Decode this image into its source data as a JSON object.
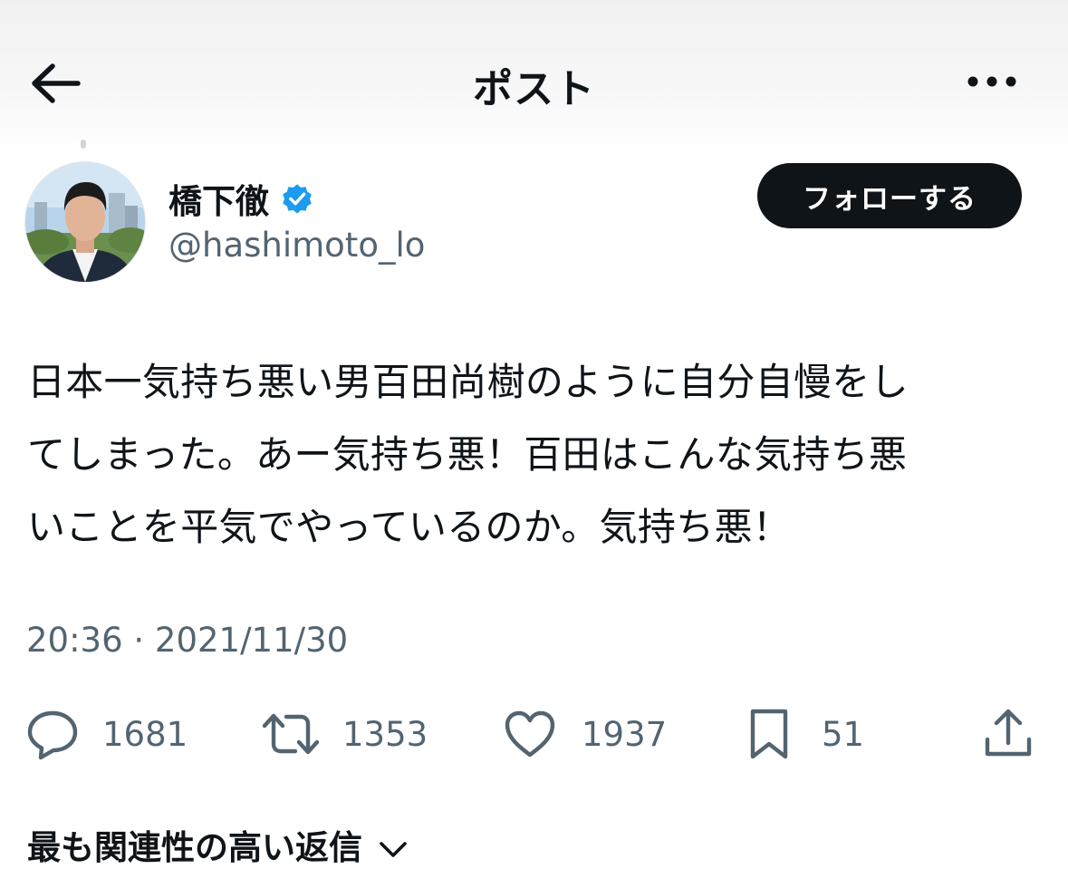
{
  "header": {
    "title": "ポスト",
    "back_icon": "arrow-left-icon",
    "more_icon": "more-horizontal-icon"
  },
  "author": {
    "name": "橋下徹",
    "handle": "@hashimoto_lo",
    "verified": true,
    "verified_color": "#1d9bf0",
    "follow_label": "フォローする"
  },
  "post": {
    "lines": [
      "日本一気持ち悪い男百田尚樹のように自分自慢をし",
      "てしまった。あー気持ち悪！百田はこんな気持ち悪",
      "いことを平気でやっているのか。気持ち悪！"
    ],
    "timestamp": "20:36 · 2021/11/30"
  },
  "actions": {
    "replies": "1681",
    "reposts": "1353",
    "likes": "1937",
    "bookmarks": "51",
    "share_icon": "share-icon"
  },
  "replies_sort": {
    "label": "最も関連性の高い返信",
    "icon": "chevron-down-icon"
  },
  "colors": {
    "text_primary": "#0f1419",
    "text_secondary": "#536471",
    "follow_bg": "#0f1419"
  }
}
